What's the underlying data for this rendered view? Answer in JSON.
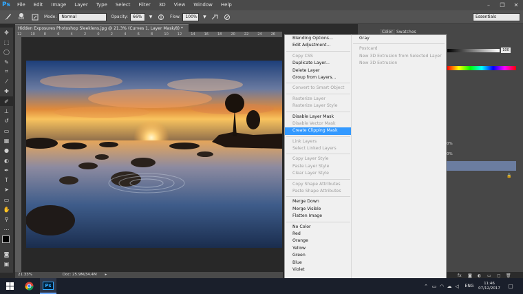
{
  "app": {
    "logo": "Ps"
  },
  "menubar": {
    "items": [
      "File",
      "Edit",
      "Image",
      "Layer",
      "Type",
      "Select",
      "Filter",
      "3D",
      "View",
      "Window",
      "Help"
    ]
  },
  "window_controls": {
    "minimize": "–",
    "restore": "❐",
    "close": "✕"
  },
  "options": {
    "brush_size": "600",
    "mode_label": "Mode:",
    "mode_value": "Normal",
    "opacity_label": "Opacity:",
    "opacity_value": "66%",
    "flow_label": "Flow:",
    "flow_value": "100%",
    "workspace": "Essentials"
  },
  "document": {
    "tab_title": "Hidden Exposures Photoshop Sleeklens.jpg @ 21.3% (Curves 1, Layer Mask/8) *",
    "tab_close": "×",
    "zoom": "21.33%",
    "doc_size": "Doc: 25.9M/34.4M",
    "ruler_ticks": [
      "12",
      "10",
      "8",
      "6",
      "4",
      "2",
      "0",
      "2",
      "4",
      "6",
      "8",
      "10",
      "12",
      "14",
      "16",
      "18",
      "20",
      "22",
      "24",
      "26"
    ]
  },
  "panels": {
    "color_tab": "Color",
    "swatches_tab": "Swatches",
    "slider_value": "100",
    "percent_a": "0%",
    "percent_b": "0%"
  },
  "context_menu": {
    "items": [
      {
        "label": "Blending Options...",
        "state": "enabled"
      },
      {
        "label": "Edit Adjustment...",
        "state": "enabled"
      },
      {
        "sep": true
      },
      {
        "label": "Copy CSS",
        "state": "disabled"
      },
      {
        "label": "Duplicate Layer...",
        "state": "enabled"
      },
      {
        "label": "Delete Layer",
        "state": "enabled"
      },
      {
        "label": "Group from Layers...",
        "state": "enabled"
      },
      {
        "sep": true
      },
      {
        "label": "Convert to Smart Object",
        "state": "disabled"
      },
      {
        "sep": true
      },
      {
        "label": "Rasterize Layer",
        "state": "disabled"
      },
      {
        "label": "Rasterize Layer Style",
        "state": "disabled"
      },
      {
        "sep": true
      },
      {
        "label": "Disable Layer Mask",
        "state": "enabled"
      },
      {
        "label": "Disable Vector Mask",
        "state": "disabled"
      },
      {
        "label": "Create Clipping Mask",
        "state": "highlighted"
      },
      {
        "sep": true
      },
      {
        "label": "Link Layers",
        "state": "disabled"
      },
      {
        "label": "Select Linked Layers",
        "state": "disabled"
      },
      {
        "sep": true
      },
      {
        "label": "Copy Layer Style",
        "state": "disabled"
      },
      {
        "label": "Paste Layer Style",
        "state": "disabled"
      },
      {
        "label": "Clear Layer Style",
        "state": "disabled"
      },
      {
        "sep": true
      },
      {
        "label": "Copy Shape Attributes",
        "state": "disabled"
      },
      {
        "label": "Paste Shape Attributes",
        "state": "disabled"
      },
      {
        "sep": true
      },
      {
        "label": "Merge Down",
        "state": "enabled"
      },
      {
        "label": "Merge Visible",
        "state": "enabled"
      },
      {
        "label": "Flatten Image",
        "state": "enabled"
      },
      {
        "sep": true
      },
      {
        "label": "No Color",
        "state": "enabled"
      },
      {
        "label": "Red",
        "state": "enabled"
      },
      {
        "label": "Orange",
        "state": "enabled"
      },
      {
        "label": "Yellow",
        "state": "enabled"
      },
      {
        "label": "Green",
        "state": "enabled"
      },
      {
        "label": "Blue",
        "state": "enabled"
      },
      {
        "label": "Violet",
        "state": "enabled"
      }
    ]
  },
  "submenu": {
    "items": [
      {
        "label": "Gray",
        "state": "enabled"
      },
      {
        "sep": true
      },
      {
        "label": "Postcard",
        "state": "disabled"
      },
      {
        "label": "New 3D Extrusion from Selected Layer",
        "state": "disabled"
      },
      {
        "label": "New 3D Extrusion",
        "state": "disabled"
      }
    ]
  },
  "taskbar": {
    "language": "ENG",
    "time": "11:46",
    "date": "07/12/2017",
    "ps_label": "Ps"
  },
  "colors": {
    "highlight": "#3399ff",
    "ps_blue": "#31a8ff",
    "taskbar": "#1a1f2b"
  }
}
